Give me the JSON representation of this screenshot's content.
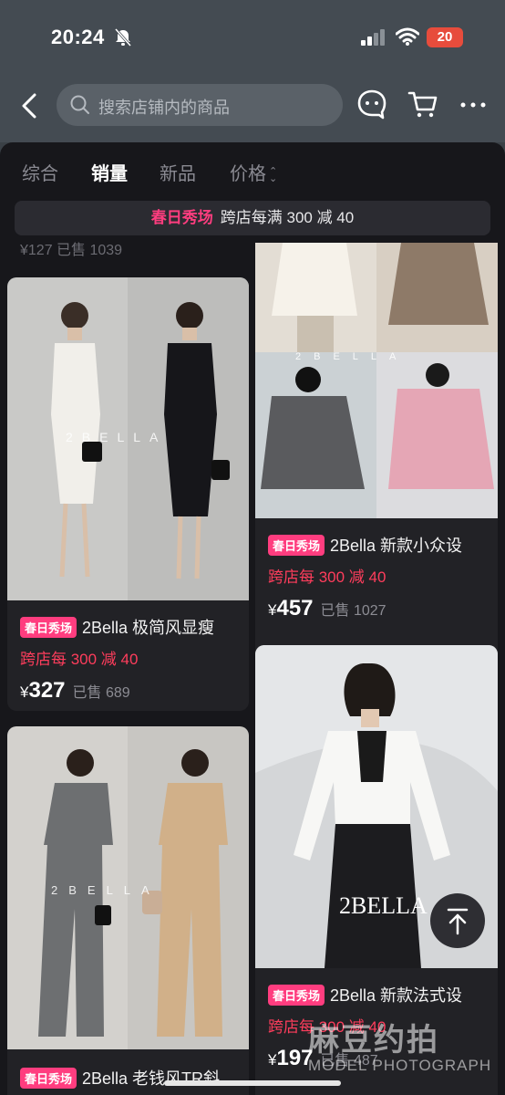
{
  "status_bar": {
    "time": "20:24",
    "battery": "20"
  },
  "header": {
    "search_placeholder": "搜索店铺内的商品"
  },
  "sort_tabs": [
    {
      "label": "综合"
    },
    {
      "label": "销量"
    },
    {
      "label": "新品"
    },
    {
      "label": "价格"
    }
  ],
  "promo_bar": {
    "highlight": "春日秀场",
    "text": "跨店每满 300 减 40"
  },
  "peek_row": {
    "text": "¥127 已售 1039"
  },
  "products": [
    {
      "badge": "春日秀场",
      "title": "2Bella 极简风显瘦",
      "discount": "跨店每 300 减 40",
      "currency": "¥",
      "price": "327",
      "sold": "已售 689",
      "photo_brand": "2 B E L L A"
    },
    {
      "badge": "春日秀场",
      "title": "2Bella 新款小众设",
      "discount": "跨店每 300 减 40",
      "currency": "¥",
      "price": "457",
      "sold": "已售 1027",
      "photo_brand": "2 B E L L A"
    },
    {
      "badge": "春日秀场",
      "title": "2Bella 老钱风TR斜",
      "discount": "",
      "currency": "¥",
      "price": "",
      "sold": "",
      "photo_brand": "2 B E L L A"
    },
    {
      "badge": "春日秀场",
      "title": "2Bella 新款法式设",
      "discount": "跨店每 300 减 40",
      "currency": "¥",
      "price": "197",
      "sold": "已售 487",
      "photo_brand": "2BELLA"
    }
  ],
  "watermark": {
    "main": "麻豆约拍",
    "sub": "MODEL PHOTOGRAPH"
  },
  "colors": {
    "accent_pink": "#ff3d7f",
    "discount_red": "#ff3d5c",
    "panel_bg": "#17171b"
  }
}
